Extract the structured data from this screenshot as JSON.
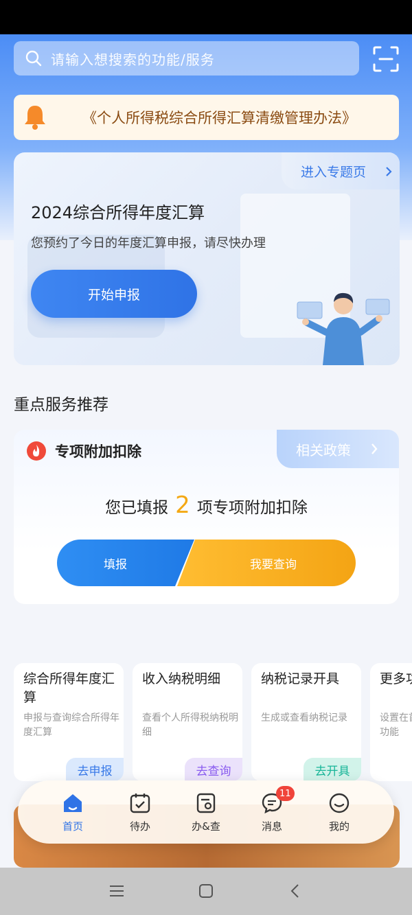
{
  "search": {
    "placeholder": "请输入想搜索的功能/服务"
  },
  "notice": {
    "text": "《个人所得税综合所得汇算清缴管理办法》"
  },
  "hero": {
    "topic_link": "进入专题页",
    "title": "2024综合所得年度汇算",
    "subtitle": "您预约了今日的年度汇算申报，请尽快办理",
    "start_button": "开始申报"
  },
  "section_title": "重点服务推荐",
  "deduction": {
    "title": "专项附加扣除",
    "policy_link": "相关政策",
    "summary_prefix": "您已填报",
    "count": "2",
    "summary_suffix": "项专项附加扣除",
    "fill_button": "填报",
    "query_button": "我要查询"
  },
  "services": [
    {
      "name": "综合所得年度汇算",
      "desc": "申报与查询综合所得年度汇算",
      "tag": "去申报",
      "icon": "calculator-icon",
      "color": "#2f7ff0"
    },
    {
      "name": "收入纳税明细",
      "desc": "查看个人所得税纳税明细",
      "tag": "去查询",
      "icon": "wallet-icon",
      "color": "#8a5cf0"
    },
    {
      "name": "纳税记录开具",
      "desc": "生成或查看纳税记录",
      "tag": "去开具",
      "icon": "stamp-icon",
      "color": "#17c2a4"
    },
    {
      "name": "更多功能",
      "desc": "设置在首页展示的常用功能",
      "tag": "",
      "icon": "apps-search-icon",
      "color": "#2f7ff0"
    }
  ],
  "tabbar": {
    "home": "首页",
    "todo": "待办",
    "handle": "办&查",
    "messages": "消息",
    "messages_badge": "11",
    "mine": "我的"
  },
  "colors": {
    "primary": "#2f73e6",
    "accent": "#f4a814"
  }
}
